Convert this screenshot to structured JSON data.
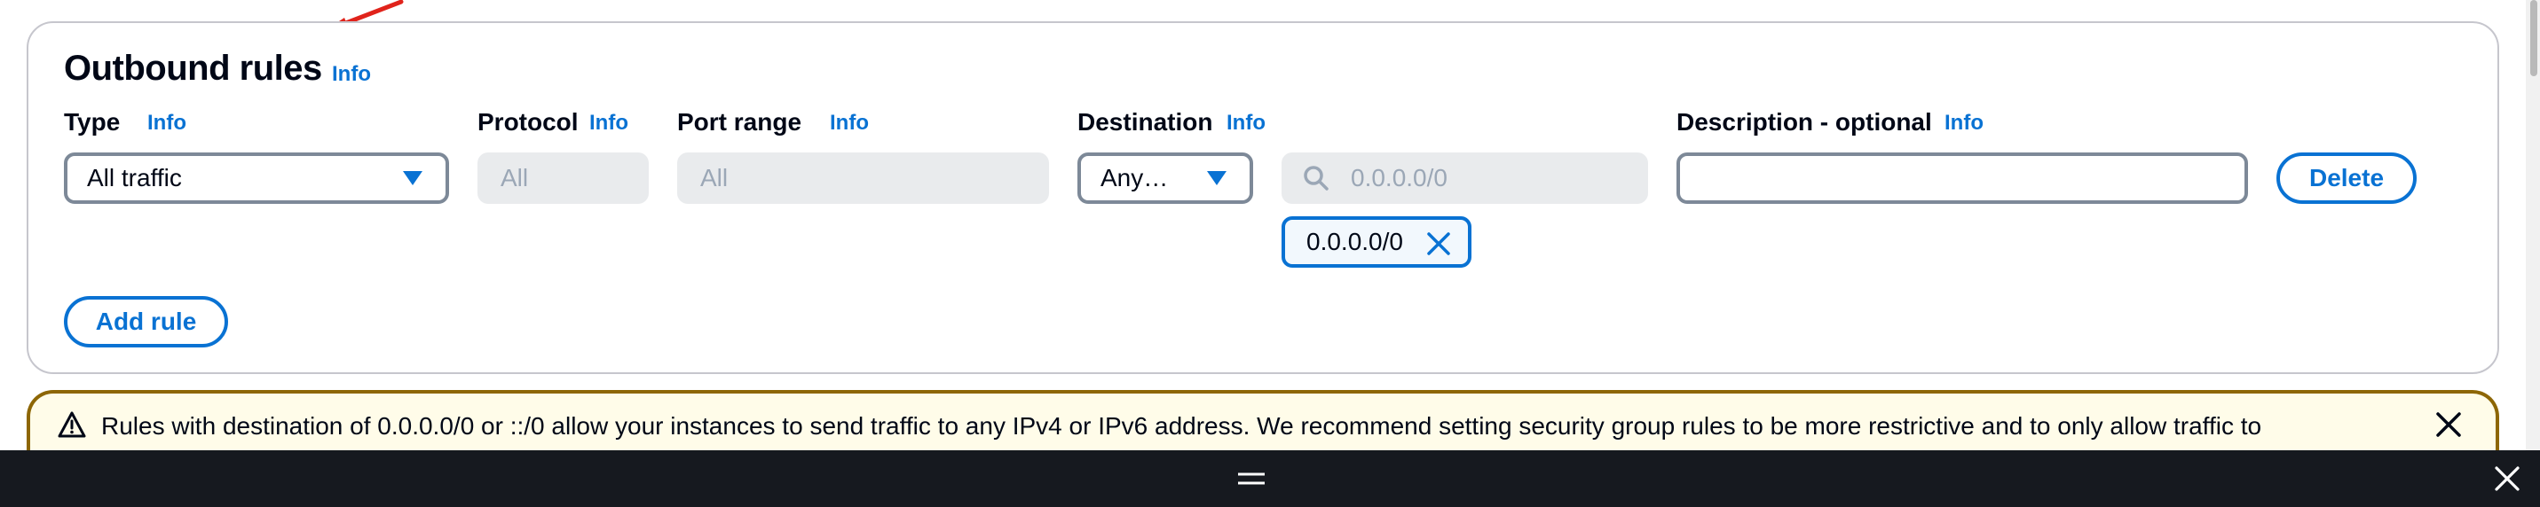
{
  "panel": {
    "title": "Outbound rules",
    "title_info": "Info"
  },
  "columns": {
    "type": {
      "label": "Type",
      "info": "Info"
    },
    "protocol": {
      "label": "Protocol",
      "info": "Info"
    },
    "port_range": {
      "label": "Port range",
      "info": "Info"
    },
    "destination": {
      "label": "Destination",
      "info": "Info"
    },
    "description": {
      "label": "Description - optional",
      "info": "Info"
    }
  },
  "rule": {
    "type_value": "All traffic",
    "protocol_value": "All",
    "port_range_value": "All",
    "destination_select": "Any…",
    "destination_search_placeholder": "0.0.0.0/0",
    "destination_token": "0.0.0.0/0",
    "description_value": "",
    "delete_label": "Delete"
  },
  "add_rule_label": "Add rule",
  "alert": {
    "text": "Rules with destination of 0.0.0.0/0 or ::/0 allow your instances to send traffic to any IPv4 or IPv6 address. We recommend setting security group rules to be more restrictive and to only allow traffic to"
  },
  "colors": {
    "link_blue": "#0972d3",
    "annotation_red": "#e0231b",
    "warning_border": "#8d6605",
    "bottom_bar": "#16191f"
  },
  "icons": {
    "caret": "caret-down-icon",
    "search": "search-icon",
    "token_remove": "close-icon",
    "warning": "warning-icon",
    "alert_dismiss": "close-icon",
    "drag_handle": "drag-handle-icon",
    "bar_close": "close-icon"
  }
}
